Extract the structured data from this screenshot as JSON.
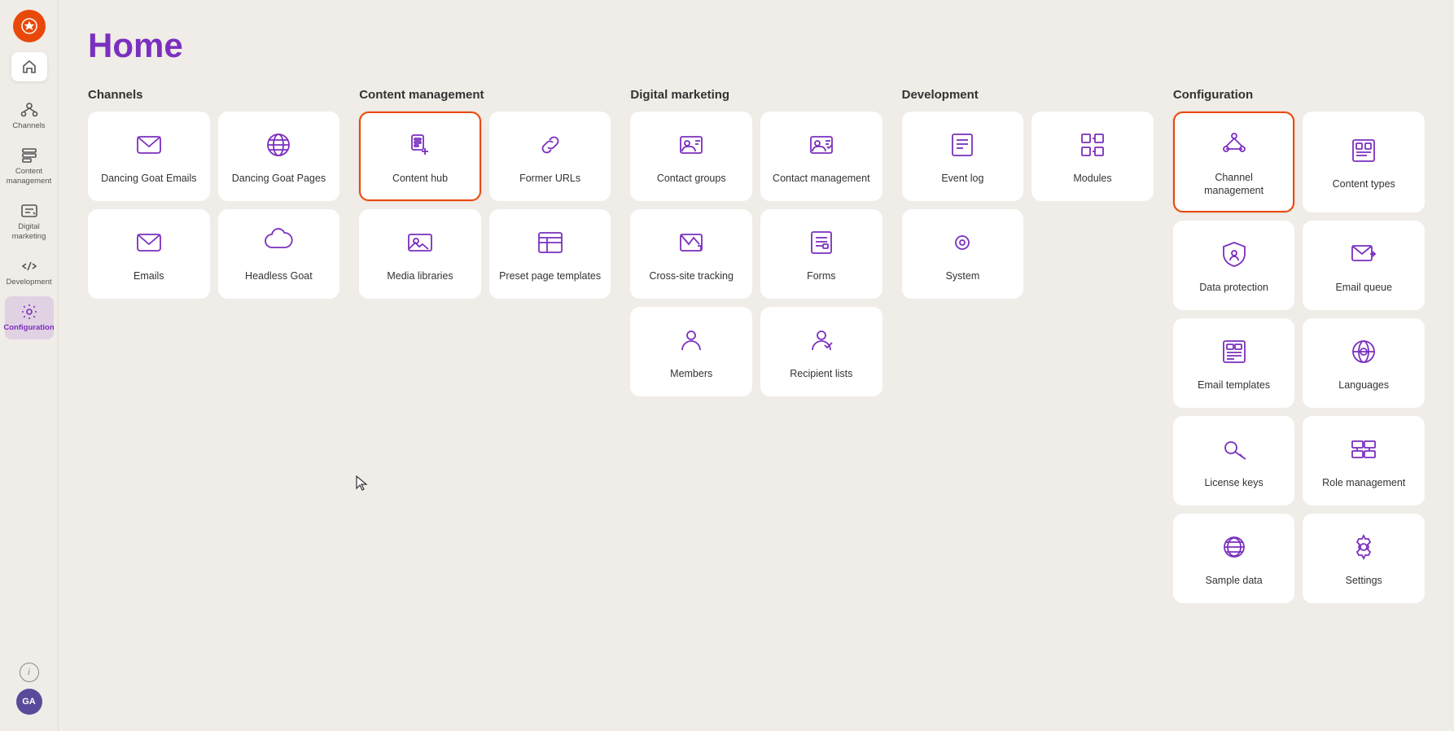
{
  "page": {
    "title": "Home"
  },
  "sidebar": {
    "logo_alt": "Kentico logo",
    "home_icon": "home",
    "nav_items": [
      {
        "id": "channels",
        "label": "Channels",
        "icon": "channels"
      },
      {
        "id": "content-management",
        "label": "Content management",
        "icon": "content-management",
        "active": false
      },
      {
        "id": "digital-marketing",
        "label": "Digital marketing",
        "icon": "digital-marketing"
      },
      {
        "id": "development",
        "label": "Development",
        "icon": "development"
      },
      {
        "id": "configuration",
        "label": "Configuration",
        "icon": "configuration",
        "active": true
      }
    ],
    "info_label": "i",
    "avatar_label": "GA"
  },
  "sections": [
    {
      "id": "channels",
      "title": "Channels",
      "cards": [
        {
          "id": "dancing-goat-emails",
          "label": "Dancing Goat Emails",
          "icon": "email",
          "highlighted": false
        },
        {
          "id": "dancing-goat-pages",
          "label": "Dancing Goat Pages",
          "icon": "globe",
          "highlighted": false
        },
        {
          "id": "emails",
          "label": "Emails",
          "icon": "email-small",
          "highlighted": false
        },
        {
          "id": "headless-goat",
          "label": "Headless Goat",
          "icon": "cloud",
          "highlighted": false
        }
      ]
    },
    {
      "id": "content-management",
      "title": "Content management",
      "cards": [
        {
          "id": "content-hub",
          "label": "Content hub",
          "icon": "content-hub",
          "highlighted": true
        },
        {
          "id": "former-urls",
          "label": "Former URLs",
          "icon": "link",
          "highlighted": false
        },
        {
          "id": "media-libraries",
          "label": "Media libraries",
          "icon": "media",
          "highlighted": false
        },
        {
          "id": "preset-page-templates",
          "label": "Preset page templates",
          "icon": "preset",
          "highlighted": false
        }
      ]
    },
    {
      "id": "digital-marketing",
      "title": "Digital marketing",
      "cards": [
        {
          "id": "contact-groups",
          "label": "Contact groups",
          "icon": "contact-groups",
          "highlighted": false
        },
        {
          "id": "contact-management",
          "label": "Contact management",
          "icon": "contact-mgmt",
          "highlighted": false
        },
        {
          "id": "cross-site-tracking",
          "label": "Cross-site tracking",
          "icon": "tracking",
          "highlighted": false
        },
        {
          "id": "forms",
          "label": "Forms",
          "icon": "forms",
          "highlighted": false
        },
        {
          "id": "members",
          "label": "Members",
          "icon": "members",
          "highlighted": false
        },
        {
          "id": "recipient-lists",
          "label": "Recipient lists",
          "icon": "recipients",
          "highlighted": false
        }
      ]
    },
    {
      "id": "development",
      "title": "Development",
      "cards": [
        {
          "id": "event-log",
          "label": "Event log",
          "icon": "event-log",
          "highlighted": false
        },
        {
          "id": "modules",
          "label": "Modules",
          "icon": "modules",
          "highlighted": false
        },
        {
          "id": "system",
          "label": "System",
          "icon": "system",
          "highlighted": false
        }
      ]
    },
    {
      "id": "configuration",
      "title": "Configuration",
      "cards": [
        {
          "id": "channel-management",
          "label": "Channel management",
          "icon": "channel-mgmt",
          "highlighted": true
        },
        {
          "id": "content-types",
          "label": "Content types",
          "icon": "content-types",
          "highlighted": false
        },
        {
          "id": "data-protection",
          "label": "Data protection",
          "icon": "data-protection",
          "highlighted": false
        },
        {
          "id": "email-queue",
          "label": "Email queue",
          "icon": "email-queue",
          "highlighted": false
        },
        {
          "id": "email-templates",
          "label": "Email templates",
          "icon": "email-templates",
          "highlighted": false
        },
        {
          "id": "languages",
          "label": "Languages",
          "icon": "languages",
          "highlighted": false
        },
        {
          "id": "license-keys",
          "label": "License keys",
          "icon": "license-keys",
          "highlighted": false
        },
        {
          "id": "role-management",
          "label": "Role management",
          "icon": "role-mgmt",
          "highlighted": false
        },
        {
          "id": "sample-data",
          "label": "Sample data",
          "icon": "sample-data",
          "highlighted": false
        },
        {
          "id": "settings",
          "label": "Settings",
          "icon": "settings",
          "highlighted": false
        }
      ]
    }
  ]
}
